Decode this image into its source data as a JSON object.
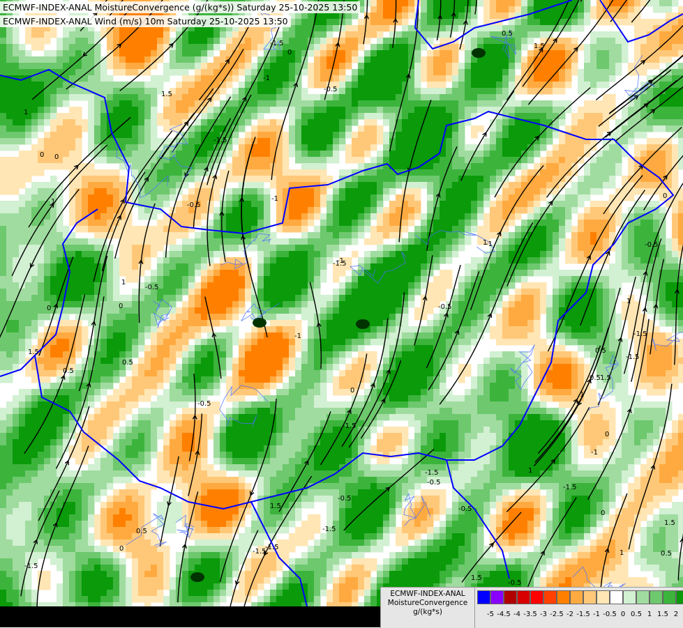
{
  "header": {
    "line1": "ECMWF-INDEX-ANAL MoistureConvergence (g/(kg*s)) Saturday 25-10-2025 13:50",
    "line2": "ECMWF-INDEX-ANAL Wind (m/s) 10m Saturday 25-10-2025 13:50"
  },
  "legend": {
    "title_line1": "ECMWF-INDEX-ANAL",
    "title_line2": "MoistureConvergence",
    "title_line3": "g/(kg*s)",
    "colors": [
      "#0000ff",
      "#8a00ff",
      "#b00000",
      "#d80000",
      "#ff0000",
      "#ff4000",
      "#ff8000",
      "#ffaa40",
      "#ffc878",
      "#ffe6b4",
      "#ffffff",
      "#d2f0d2",
      "#a0dca0",
      "#6ec86e",
      "#3cb43c",
      "#0a9a0a"
    ],
    "ticks": [
      "-5",
      "-4.5",
      "-4",
      "-3.5",
      "-3",
      "-2.5",
      "-2",
      "-1.5",
      "-1",
      "-0.5",
      "0",
      "0.5",
      "1",
      "1.5",
      "2"
    ]
  },
  "contour_labels": [
    "0",
    "0.5",
    "-0.5",
    "1",
    "-1",
    "1.5",
    "-1.5"
  ],
  "map": {
    "layers": [
      "moisture-convergence-fill",
      "wind-streamlines",
      "country-borders",
      "rivers"
    ],
    "border_color": "#0000ff"
  }
}
